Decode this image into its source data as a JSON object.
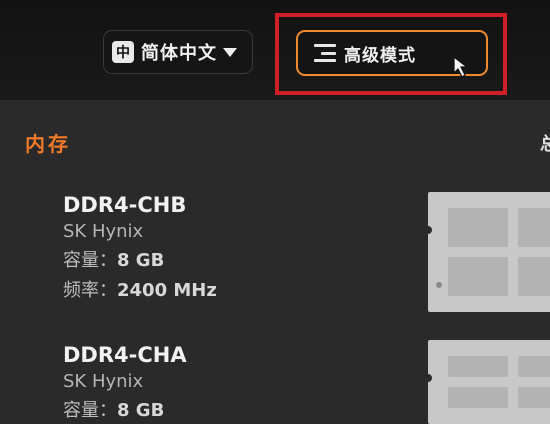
{
  "header": {
    "language": {
      "badge": "中",
      "label": "简体中文"
    },
    "mode_button": {
      "label": "高级模式"
    }
  },
  "section": {
    "title": "内存",
    "edge_text": "总"
  },
  "memory": [
    {
      "name": "DDR4-CHB",
      "brand": "SK Hynix",
      "capacity_label": "容量：",
      "capacity": "8 GB",
      "freq_label": "频率：",
      "freq": "2400 MHz"
    },
    {
      "name": "DDR4-CHA",
      "brand": "SK Hynix",
      "capacity_label": "容量：",
      "capacity": "8 GB"
    }
  ],
  "colors": {
    "accent": "#f08a2a",
    "highlight": "#d11f2a"
  }
}
